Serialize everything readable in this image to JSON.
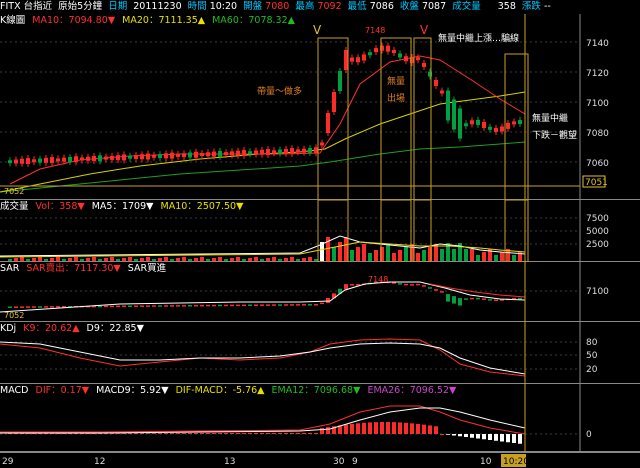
{
  "topbar": {
    "symbol": "FITX 台指近",
    "interval": "原始5分鐘",
    "chart_type": "日期",
    "date": "20111230",
    "time_label": "時間",
    "time": "10:20",
    "open_label": "開盤",
    "open": "7080",
    "high_label": "最高",
    "high": "7092",
    "low_label": "最低",
    "low": "7086",
    "close_label": "收盤",
    "close": "7087",
    "vol_label": "成交量",
    "vol": "358",
    "change_label": "漲跌",
    "change": "--"
  },
  "kline": {
    "title": "K線圖",
    "ma10": "MA10：7094.80▼",
    "ma20": "MA20：7111.35▲",
    "ma60": "MA60：7078.32▲",
    "axis": [
      "7140",
      "7120",
      "7100",
      "7080",
      "7060"
    ],
    "current_price_box": "7051",
    "low_price_label": "7052",
    "peak_label": "7148",
    "annotations": {
      "a1": "帶量～做多",
      "a2": "無量",
      "a3": "出場",
      "a4": "無量中繼上漲…騙線",
      "a5": "無量中繼",
      "a6": "下跌－觀望",
      "v_mark1": "V",
      "v_mark2": "V"
    },
    "colors": {
      "up": "#ff2a2a",
      "down": "#00a040",
      "ma10": "#ff3333",
      "ma20": "#e8e000",
      "ma60": "#22aa22",
      "box": "#c8a020"
    }
  },
  "volume": {
    "title": "成交量",
    "vol": "Vol：358▼",
    "ma5": "MA5：1709▼",
    "ma10": "MA10：2507.50▼",
    "axis": [
      "7500",
      "5000",
      "2500"
    ]
  },
  "sar": {
    "title": "SAR",
    "sar_sell": "SAR賣出：7117.30▼",
    "sar_buy": "SAR買進",
    "axis": [
      "7100"
    ],
    "peak_label": "7148",
    "low_label": "7052"
  },
  "kd": {
    "title": "KDj",
    "k": "K9：20.62▲",
    "d": "D9：22.85▼",
    "axis": [
      "80",
      "50",
      "20"
    ]
  },
  "macd": {
    "title": "MACD",
    "dif": "DIF：0.17▼",
    "macd9": "MACD9：5.92▼",
    "difmacd": "DIF-MACD：-5.76▲",
    "ema12": "EMA12：7096.68▼",
    "ema26": "EMA26：7096.52▼",
    "axis": [
      "0"
    ]
  },
  "xaxis": {
    "labels": [
      "29",
      "12",
      "13",
      "30",
      "9",
      "10",
      "10:20"
    ]
  }
}
